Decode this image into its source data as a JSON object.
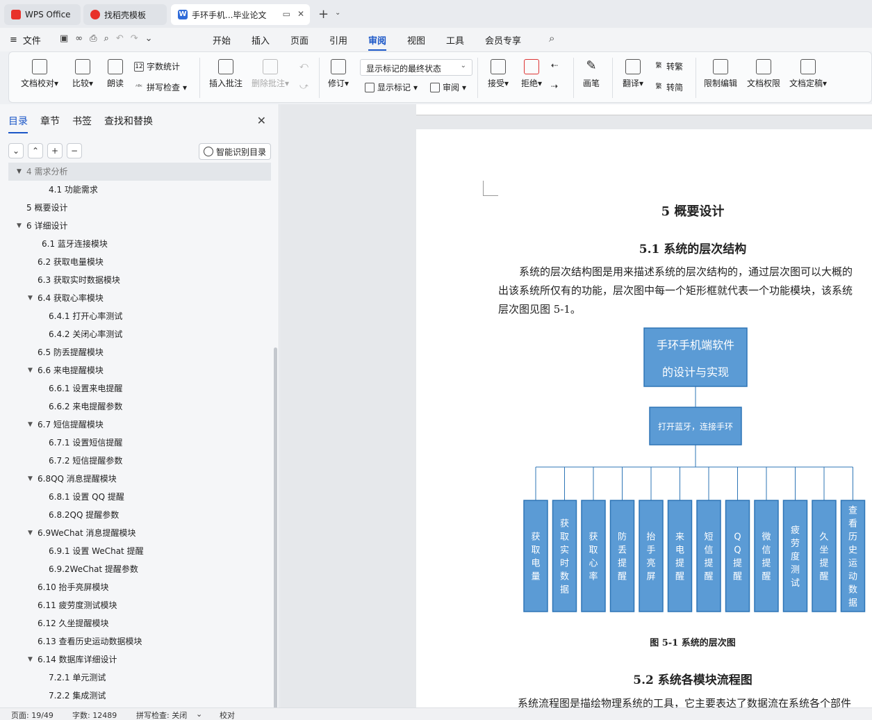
{
  "tabs": {
    "wps": "WPS Office",
    "template": "找稻壳模板",
    "doc": "手环手机...毕业论文"
  },
  "menu": {
    "file": "文件",
    "items": [
      "开始",
      "插入",
      "页面",
      "引用",
      "审阅",
      "视图",
      "工具",
      "会员专享"
    ],
    "active": "审阅"
  },
  "ribbon": {
    "doc_check": "文档校对",
    "compare": "比较",
    "read_aloud": "朗读",
    "word_count": "字数统计",
    "spell_check": "拼写检查",
    "insert_comment": "插入批注",
    "delete_comment": "删除批注",
    "revise": "修订",
    "markup_state": "显示标记的最终状态",
    "show_markup": "显示标记",
    "review": "审阅",
    "accept": "接受",
    "reject": "拒绝",
    "pen": "画笔",
    "translate": "翻译",
    "to_traditional": "转繁",
    "to_simplified": "转简",
    "restrict_edit": "限制编辑",
    "doc_permission": "文档权限",
    "doc_finalize": "文档定稿"
  },
  "sidebar": {
    "tabs": [
      "目录",
      "章节",
      "书签",
      "查找和替换"
    ],
    "smart_toc": "智能识别目录",
    "toc": [
      {
        "label": "4  需求分析",
        "level": 0,
        "expand": true,
        "highlight": true
      },
      {
        "label": "4.1 功能需求",
        "level": 2
      },
      {
        "label": "5  概要设计",
        "level": 0
      },
      {
        "label": "6  详细设计",
        "level": 0,
        "expand": true
      },
      {
        "label": "6.1 蓝牙连接模块",
        "level": 1.3
      },
      {
        "label": "6.2 获取电量模块",
        "level": 1
      },
      {
        "label": "6.3 获取实时数据模块",
        "level": 1
      },
      {
        "label": "6.4 获取心率模块",
        "level": 1,
        "expand": true
      },
      {
        "label": "6.4.1 打开心率测试",
        "level": 2
      },
      {
        "label": "6.4.2 关闭心率测试",
        "level": 2
      },
      {
        "label": "6.5 防丢提醒模块",
        "level": 1
      },
      {
        "label": "6.6 来电提醒模块",
        "level": 1,
        "expand": true
      },
      {
        "label": "6.6.1 设置来电提醒",
        "level": 2
      },
      {
        "label": "6.6.2 来电提醒参数",
        "level": 2
      },
      {
        "label": "6.7 短信提醒模块",
        "level": 1,
        "expand": true
      },
      {
        "label": "6.7.1 设置短信提醒",
        "level": 2
      },
      {
        "label": "6.7.2 短信提醒参数",
        "level": 2
      },
      {
        "label": "6.8QQ 消息提醒模块",
        "level": 1,
        "expand": true
      },
      {
        "label": "6.8.1 设置 QQ 提醒",
        "level": 2
      },
      {
        "label": "6.8.2QQ 提醒参数",
        "level": 2
      },
      {
        "label": "6.9WeChat 消息提醒模块",
        "level": 1,
        "expand": true
      },
      {
        "label": "6.9.1 设置 WeChat 提醒",
        "level": 2
      },
      {
        "label": "6.9.2WeChat 提醒参数",
        "level": 2
      },
      {
        "label": "6.10 抬手亮屏模块",
        "level": 1
      },
      {
        "label": "6.11 疲劳度测试模块",
        "level": 1
      },
      {
        "label": "6.12 久坐提醒模块",
        "level": 1
      },
      {
        "label": "6.13 查看历史运动数据模块",
        "level": 1
      },
      {
        "label": "6.14 数据库详细设计",
        "level": 1,
        "expand": true
      },
      {
        "label": "7.2.1 单元测试",
        "level": 2
      },
      {
        "label": "7.2.2 集成测试",
        "level": 2
      }
    ]
  },
  "document": {
    "heading1": "5  概要设计",
    "heading2a": "5.1 系统的层次结构",
    "para_lines": [
      "系统的层次结构图是用来描述系统的层次结构的，通过层次图可以大概的",
      "出该系统所仅有的功能，层次图中每一个矩形框就代表一个功能模块，该系统",
      "层次图见图 5-1。"
    ],
    "diagram": {
      "root_lines": [
        "手环手机端软件",
        "的设计与实现"
      ],
      "mid": "打开蓝牙，连接手环",
      "leaves": [
        "获取电量",
        "获取实时数据",
        "获取心率",
        "防丢提醒",
        "抬手亮屏",
        "来电提醒",
        "短信提醒",
        "QQ提醒",
        "微信提醒",
        "疲劳度测试",
        "久坐提醒",
        "查看历史运动数据"
      ]
    },
    "caption": "图 5-1  系统的层次图",
    "heading2b": "5.2 系统各模块流程图",
    "para2": "系统流程图是描绘物理系统的工具，它主要表达了数据流在系统各个部件"
  },
  "status": {
    "page": "页面: 19/49",
    "words": "字数: 12489",
    "spell": "拼写检查: 关闭",
    "proof": "校对"
  },
  "colors": {
    "accent": "#1a56c7",
    "box_fill": "#5b9bd5",
    "box_border": "#2e75b6"
  }
}
